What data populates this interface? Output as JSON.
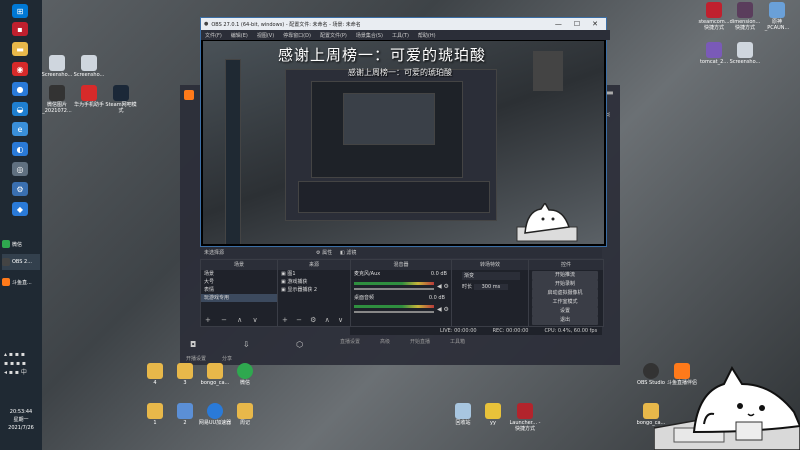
{
  "window": {
    "title": "OBS 27.0.1 (64-bit, windows) - 配置文件: 未命名 - 场景: 未命名",
    "menu": [
      "文件(F)",
      "编辑(E)",
      "视图(V)",
      "停靠窗口(D)",
      "配置文件(P)",
      "场景集合(S)",
      "工具(T)",
      "帮助(H)"
    ],
    "controls": [
      "—",
      "☐",
      "✕"
    ]
  },
  "banner": {
    "line1": "感谢上周榜一：可爱的琥珀酸",
    "line2": "感谢上周榜一：可爱的琥珀酸"
  },
  "obs": {
    "tabs": [
      "属性",
      "滤镜"
    ],
    "status_left": "未选择源",
    "docks": {
      "scenes": "场景",
      "sources": "来源",
      "mixer": "混音器",
      "transitions": "转场特效",
      "controls": "控件"
    },
    "scenes": [
      "场景",
      "大号",
      "表情",
      "玩游戏专用"
    ],
    "sources": [
      "图1",
      "游戏捕获",
      "显示器捕获 2"
    ],
    "mixer": [
      {
        "name": "麦克风/Aux",
        "db": "0.0 dB"
      },
      {
        "name": "桌面音频",
        "db": "0.0 dB"
      }
    ],
    "transition": {
      "select": "渐变",
      "duration_label": "时长",
      "duration": "300 ms"
    },
    "controls": [
      "开始推流",
      "开始录制",
      "启动虚拟摄像机",
      "工作室模式",
      "设置",
      "退出"
    ],
    "status": [
      "LIVE: 00:00:00",
      "REC: 00:00:00",
      "CPU: 0.4%, 60.00 fps"
    ],
    "underlay": [
      "直播设置",
      "高级",
      "开始直播",
      "工具箱",
      "开播设置",
      "分享"
    ]
  },
  "taskbar": {
    "apps": [
      {
        "label": "微信",
        "color": "#2fa84f"
      },
      {
        "label": "OBS 2...",
        "color": "#444444"
      },
      {
        "label": "斗鱼直...",
        "color": "#ff7a1a"
      }
    ],
    "time": "20:53:44",
    "weekday": "星期一",
    "date": "2021/7/26"
  },
  "desktop": {
    "top_left": [
      {
        "label": "Screensho...",
        "color": "#cfd6de"
      },
      {
        "label": "Screensho...",
        "color": "#cfd6de"
      },
      {
        "label": "微信图片_2021072...",
        "color": "#333333"
      },
      {
        "label": "华为手机助手",
        "color": "#d72a2a"
      },
      {
        "label": "Steam网吧模式",
        "color": "#1b2838"
      }
    ],
    "top_right": [
      {
        "label": "steamcom...快捷方式",
        "color": "#c0202e"
      },
      {
        "label": "dimension...快捷方式",
        "color": "#5a3d5c"
      },
      {
        "label": "原神_PCAUN...",
        "color": "#6aa0d8"
      },
      {
        "label": "tomcat_2...",
        "color": "#7a5ab8"
      },
      {
        "label": "Screensho...",
        "color": "#cfd6de"
      }
    ],
    "bottom_row1": [
      {
        "label": "4",
        "color": "#e8b84a"
      },
      {
        "label": "3",
        "color": "#e8b84a"
      },
      {
        "label": "bongo_ca...",
        "color": "#e8b84a"
      },
      {
        "label": "微信",
        "color": "#2fa84f"
      }
    ],
    "bottom_row2": [
      {
        "label": "1",
        "color": "#e8b84a"
      },
      {
        "label": "2",
        "color": "#5b8fd6"
      },
      {
        "label": "网易UU加速器",
        "color": "#2a7ad8"
      },
      {
        "label": "周记",
        "color": "#e8b84a"
      }
    ],
    "bottom_center": [
      {
        "label": "回收站",
        "color": "#a8c6e0"
      },
      {
        "label": "yy",
        "color": "#e8c23a"
      },
      {
        "label": "Launcher... - 快捷方式",
        "color": "#b3242c"
      }
    ],
    "bottom_right": [
      {
        "label": "OBS Studio",
        "color": "#333333"
      },
      {
        "label": "斗鱼直播伴侣",
        "color": "#ff7a1a"
      },
      {
        "label": "bongo_ca...",
        "color": "#e8b84a"
      }
    ]
  },
  "accent": "#3b6ea5"
}
